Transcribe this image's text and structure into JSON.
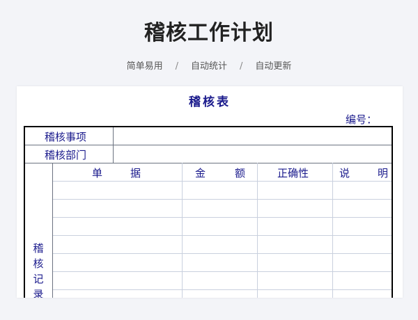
{
  "page": {
    "title": "稽核工作计划",
    "features": [
      "简单易用",
      "自动统计",
      "自动更新"
    ],
    "separator": "/"
  },
  "form": {
    "title": "稽核表",
    "serial_label": "编号：",
    "rows": {
      "item_label": "稽核事项",
      "dept_label": "稽核部门"
    },
    "record_label_chars": [
      "稽",
      "核",
      "记",
      "录"
    ],
    "columns": {
      "doc_chars": [
        "单",
        "据"
      ],
      "amount_chars": [
        "金",
        "额"
      ],
      "correct": "正确性",
      "note_chars": [
        "说",
        "明"
      ]
    }
  },
  "colors": {
    "form_text": "#1a1a8c",
    "background": "#f3f4f8"
  }
}
